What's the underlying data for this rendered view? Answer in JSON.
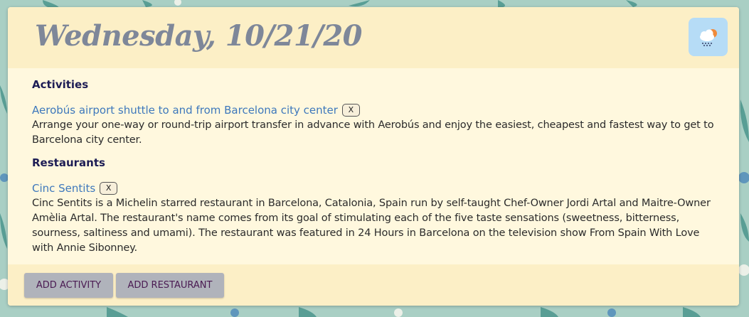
{
  "day": {
    "title": "Wednesday, 10/21/20"
  },
  "weather": {
    "icon": "rain-cloud-sun-icon"
  },
  "sections": {
    "activities": {
      "title": "Activities",
      "items": [
        {
          "name": "Aerobús airport shuttle to and from Barcelona city center",
          "remove_label": "X",
          "description": "Arrange your one-way or round-trip airport transfer in advance with Aerobús and enjoy the easiest, cheapest and fastest way to get to Barcelona city center."
        }
      ]
    },
    "restaurants": {
      "title": "Restaurants",
      "items": [
        {
          "name": "Cinc Sentits",
          "remove_label": "X",
          "description": "Cinc Sentits is a Michelin starred restaurant in Barcelona, Catalonia, Spain run by self-taught Chef-Owner Jordi Artal and Maitre-Owner Amèlia Artal. The restaurant's name comes from its goal of stimulating each of the five taste sensations (sweetness, bitterness, sourness, saltiness and umami). The restaurant was featured in 24 Hours in Barcelona on the television show From Spain With Love with Annie Sibonney."
        }
      ]
    }
  },
  "footer": {
    "add_activity_label": "ADD ACTIVITY",
    "add_restaurant_label": "ADD RESTAURANT"
  },
  "colors": {
    "background": "#a9cfc4",
    "card": "#fff8de",
    "header": "#fcefc6",
    "title": "#7e8799",
    "link": "#3e78bc",
    "weather_button": "#b6dcf6",
    "footer_button": "#b0b3bb"
  }
}
